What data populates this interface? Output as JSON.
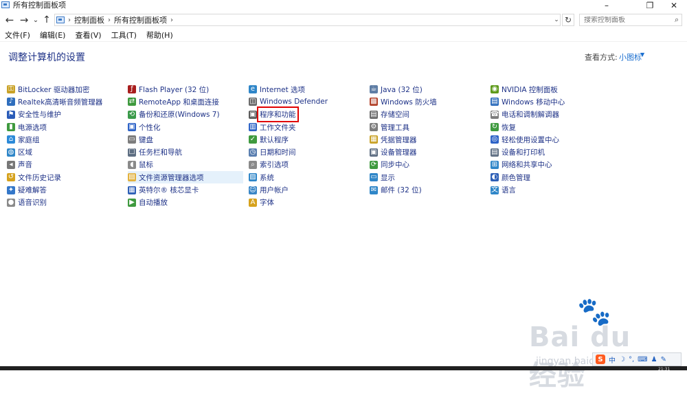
{
  "window": {
    "title": "所有控制面板项",
    "min_icon": "–",
    "max_icon": "❐",
    "close_icon": "✕"
  },
  "nav": {
    "back": "←",
    "forward": "→",
    "recent": "⌄",
    "up": "↑",
    "breadcrumbs": [
      "控制面板",
      "所有控制面板项"
    ],
    "separator": "›",
    "refresh": "↻",
    "search_placeholder": "搜索控制面板"
  },
  "menu": [
    "文件(F)",
    "编辑(E)",
    "查看(V)",
    "工具(T)",
    "帮助(H)"
  ],
  "header": {
    "title": "调整计算机的设置",
    "view_by_label": "查看方式:",
    "view_by_value": "小图标"
  },
  "columns": [
    [
      {
        "label": "BitLocker 驱动器加密",
        "icon": "key-icon",
        "color": "#c9a227"
      },
      {
        "label": "Realtek高清晰音频管理器",
        "icon": "speaker-icon",
        "color": "#2f6ebd"
      },
      {
        "label": "安全性与维护",
        "icon": "flag-icon",
        "color": "#2a5bb8"
      },
      {
        "label": "电源选项",
        "icon": "battery-icon",
        "color": "#3f9a3f"
      },
      {
        "label": "家庭组",
        "icon": "homegroup-icon",
        "color": "#2c8ad8"
      },
      {
        "label": "区域",
        "icon": "globe-icon",
        "color": "#2f86c8"
      },
      {
        "label": "声音",
        "icon": "volume-icon",
        "color": "#777777"
      },
      {
        "label": "文件历史记录",
        "icon": "history-icon",
        "color": "#d6a21d"
      },
      {
        "label": "疑难解答",
        "icon": "troubleshoot-icon",
        "color": "#3477c9"
      },
      {
        "label": "语音识别",
        "icon": "microphone-icon",
        "color": "#8a8a8a"
      }
    ],
    [
      {
        "label": "Flash Player (32 位)",
        "icon": "flash-icon",
        "color": "#a81d1d"
      },
      {
        "label": "RemoteApp 和桌面连接",
        "icon": "remote-icon",
        "color": "#3f9a3f"
      },
      {
        "label": "备份和还原(Windows 7)",
        "icon": "backup-icon",
        "color": "#3a9a4a"
      },
      {
        "label": "个性化",
        "icon": "personalize-icon",
        "color": "#2e63c7"
      },
      {
        "label": "键盘",
        "icon": "keyboard-icon",
        "color": "#7d7d7d"
      },
      {
        "label": "任务栏和导航",
        "icon": "taskbar-icon",
        "color": "#5e6e82"
      },
      {
        "label": "鼠标",
        "icon": "mouse-icon",
        "color": "#8a8a8a"
      },
      {
        "label": "文件资源管理器选项",
        "icon": "folder-options-icon",
        "color": "#e2b13c"
      },
      {
        "label": "英特尔® 核芯显卡",
        "icon": "intel-icon",
        "color": "#2e5fb6"
      },
      {
        "label": "自动播放",
        "icon": "autoplay-icon",
        "color": "#3f9a3f"
      }
    ],
    [
      {
        "label": "Internet 选项",
        "icon": "internet-icon",
        "color": "#2f86c8"
      },
      {
        "label": "Windows Defender",
        "icon": "defender-icon",
        "color": "#6a6a6a"
      },
      {
        "label": "程序和功能",
        "icon": "programs-icon",
        "color": "#5b5b5b"
      },
      {
        "label": "工作文件夹",
        "icon": "work-folders-icon",
        "color": "#2e63c7"
      },
      {
        "label": "默认程序",
        "icon": "default-programs-icon",
        "color": "#3f9a3f"
      },
      {
        "label": "日期和时间",
        "icon": "clock-icon",
        "color": "#5a7fb0"
      },
      {
        "label": "索引选项",
        "icon": "index-icon",
        "color": "#8a8a8a"
      },
      {
        "label": "系统",
        "icon": "system-icon",
        "color": "#2f86c8"
      },
      {
        "label": "用户帐户",
        "icon": "user-icon",
        "color": "#3a86c6"
      },
      {
        "label": "字体",
        "icon": "font-icon",
        "color": "#d6a21d"
      }
    ],
    [
      {
        "label": "Java (32 位)",
        "icon": "java-icon",
        "color": "#5f7ea5"
      },
      {
        "label": "Windows 防火墙",
        "icon": "firewall-icon",
        "color": "#b3432b"
      },
      {
        "label": "存储空间",
        "icon": "storage-icon",
        "color": "#6a6a6a"
      },
      {
        "label": "管理工具",
        "icon": "admin-tools-icon",
        "color": "#7d7d7d"
      },
      {
        "label": "凭据管理器",
        "icon": "credential-icon",
        "color": "#c9a227"
      },
      {
        "label": "设备管理器",
        "icon": "device-manager-icon",
        "color": "#5e6e82"
      },
      {
        "label": "同步中心",
        "icon": "sync-icon",
        "color": "#3f9a3f"
      },
      {
        "label": "显示",
        "icon": "display-icon",
        "color": "#2f86c8"
      },
      {
        "label": "邮件 (32 位)",
        "icon": "mail-icon",
        "color": "#2f86c8"
      }
    ],
    [
      {
        "label": "NVIDIA 控制面板",
        "icon": "nvidia-icon",
        "color": "#5d9a1a"
      },
      {
        "label": "Windows 移动中心",
        "icon": "mobility-icon",
        "color": "#2f6ebd"
      },
      {
        "label": "电话和调制解调器",
        "icon": "phone-icon",
        "color": "#7d7d7d"
      },
      {
        "label": "恢复",
        "icon": "recovery-icon",
        "color": "#3f9a3f"
      },
      {
        "label": "轻松使用设置中心",
        "icon": "accessibility-icon",
        "color": "#2e63c7"
      },
      {
        "label": "设备和打印机",
        "icon": "printer-icon",
        "color": "#5e6e82"
      },
      {
        "label": "网络和共享中心",
        "icon": "network-icon",
        "color": "#2f86c8"
      },
      {
        "label": "颜色管理",
        "icon": "color-icon",
        "color": "#2e5fb6"
      },
      {
        "label": "语言",
        "icon": "language-icon",
        "color": "#2f86c8"
      }
    ]
  ],
  "watermark": {
    "brand": "Bai du 经验",
    "url": "jingyan.baidu.com"
  },
  "tray": {
    "sogou": "S",
    "items": [
      "中",
      "☽",
      "°,",
      "⌨",
      "♟",
      "✎"
    ]
  },
  "taskbar": {
    "clock": "21:31"
  }
}
